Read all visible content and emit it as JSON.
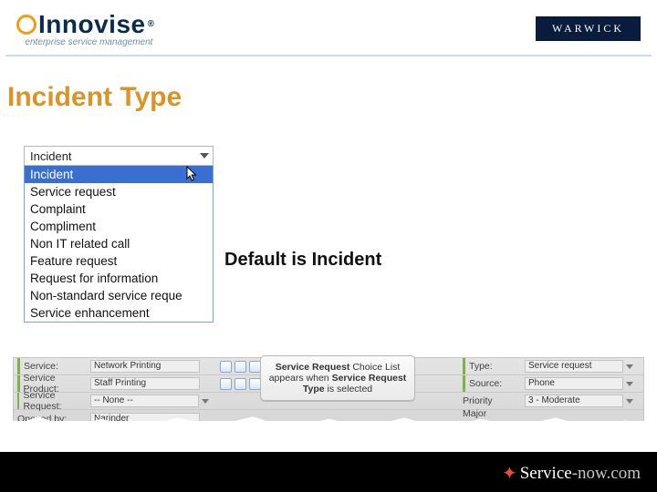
{
  "header": {
    "innovise": {
      "brand": "Innovise",
      "reg": "®",
      "tag": "enterprise service management"
    },
    "warwick": "WARWICK"
  },
  "title": "Incident Type",
  "dropdown": {
    "value": "Incident",
    "options": [
      "Incident",
      "Service request",
      "Complaint",
      "Compliment",
      "Non IT related call",
      "Feature request",
      "Request for information",
      "Non-standard service reque",
      "Service enhancement"
    ]
  },
  "note": "Default is Incident",
  "form": {
    "rows": [
      {
        "l_label": "Service:",
        "l_value": "Network Printing",
        "r_label": "Type:",
        "r_value": "Service request"
      },
      {
        "l_label": "Service Product:",
        "l_value": "Staff Printing",
        "r_label": "Source:",
        "r_value": "Phone"
      },
      {
        "l_label": "Service Request:",
        "l_value": "-- None --",
        "r_label": "Priority",
        "r_value": "3 - Moderate"
      },
      {
        "l_label": "Opened by:",
        "l_value": "Narinder",
        "r_label": "Major Incident:",
        "r_value": ""
      }
    ]
  },
  "callout": {
    "strong1": "Service Request",
    "mid1": " Choice List appears when ",
    "strong2": "Service Request Type",
    "mid2": " is selected"
  },
  "footer": {
    "sn1": "Service",
    "sn2": "-now.com"
  }
}
